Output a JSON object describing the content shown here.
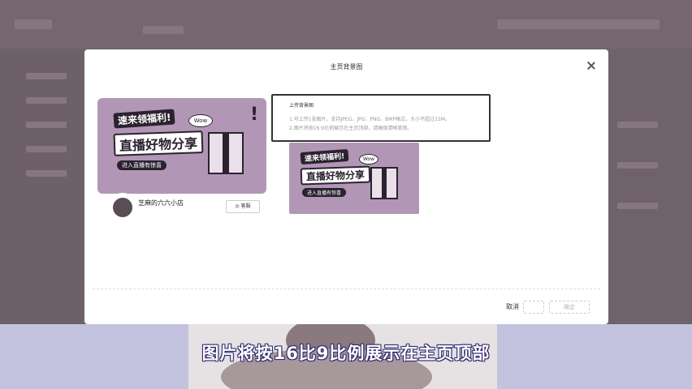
{
  "modal": {
    "title": "主页背景图",
    "cancel_label": "取消",
    "confirm_label": "确定"
  },
  "preview": {
    "banner_line1": "速来领福利!",
    "banner_line2": "直播好物分享",
    "banner_line3": "进入直播有惊喜",
    "banner_sticker": "Wow",
    "shop_name": "芝麻的六六小店",
    "service_label": "◎ 客服"
  },
  "upload": {
    "title": "上传背景图",
    "hint1": "1.可上传1张图片，支持JPEG、JPG、PNG、BMP格式，大小不超过15M。",
    "hint2": "2.图片将按16:9比例展示在主页顶部，请确保清晰美观。"
  },
  "subtitle": {
    "text": "图片将按16比9比例展示在主页顶部"
  },
  "colors": {
    "banner_bg": "#b197b5",
    "banner_ink": "#2b2230",
    "subtitle_band": "#c3c3df",
    "overlay": "#6f6268"
  }
}
